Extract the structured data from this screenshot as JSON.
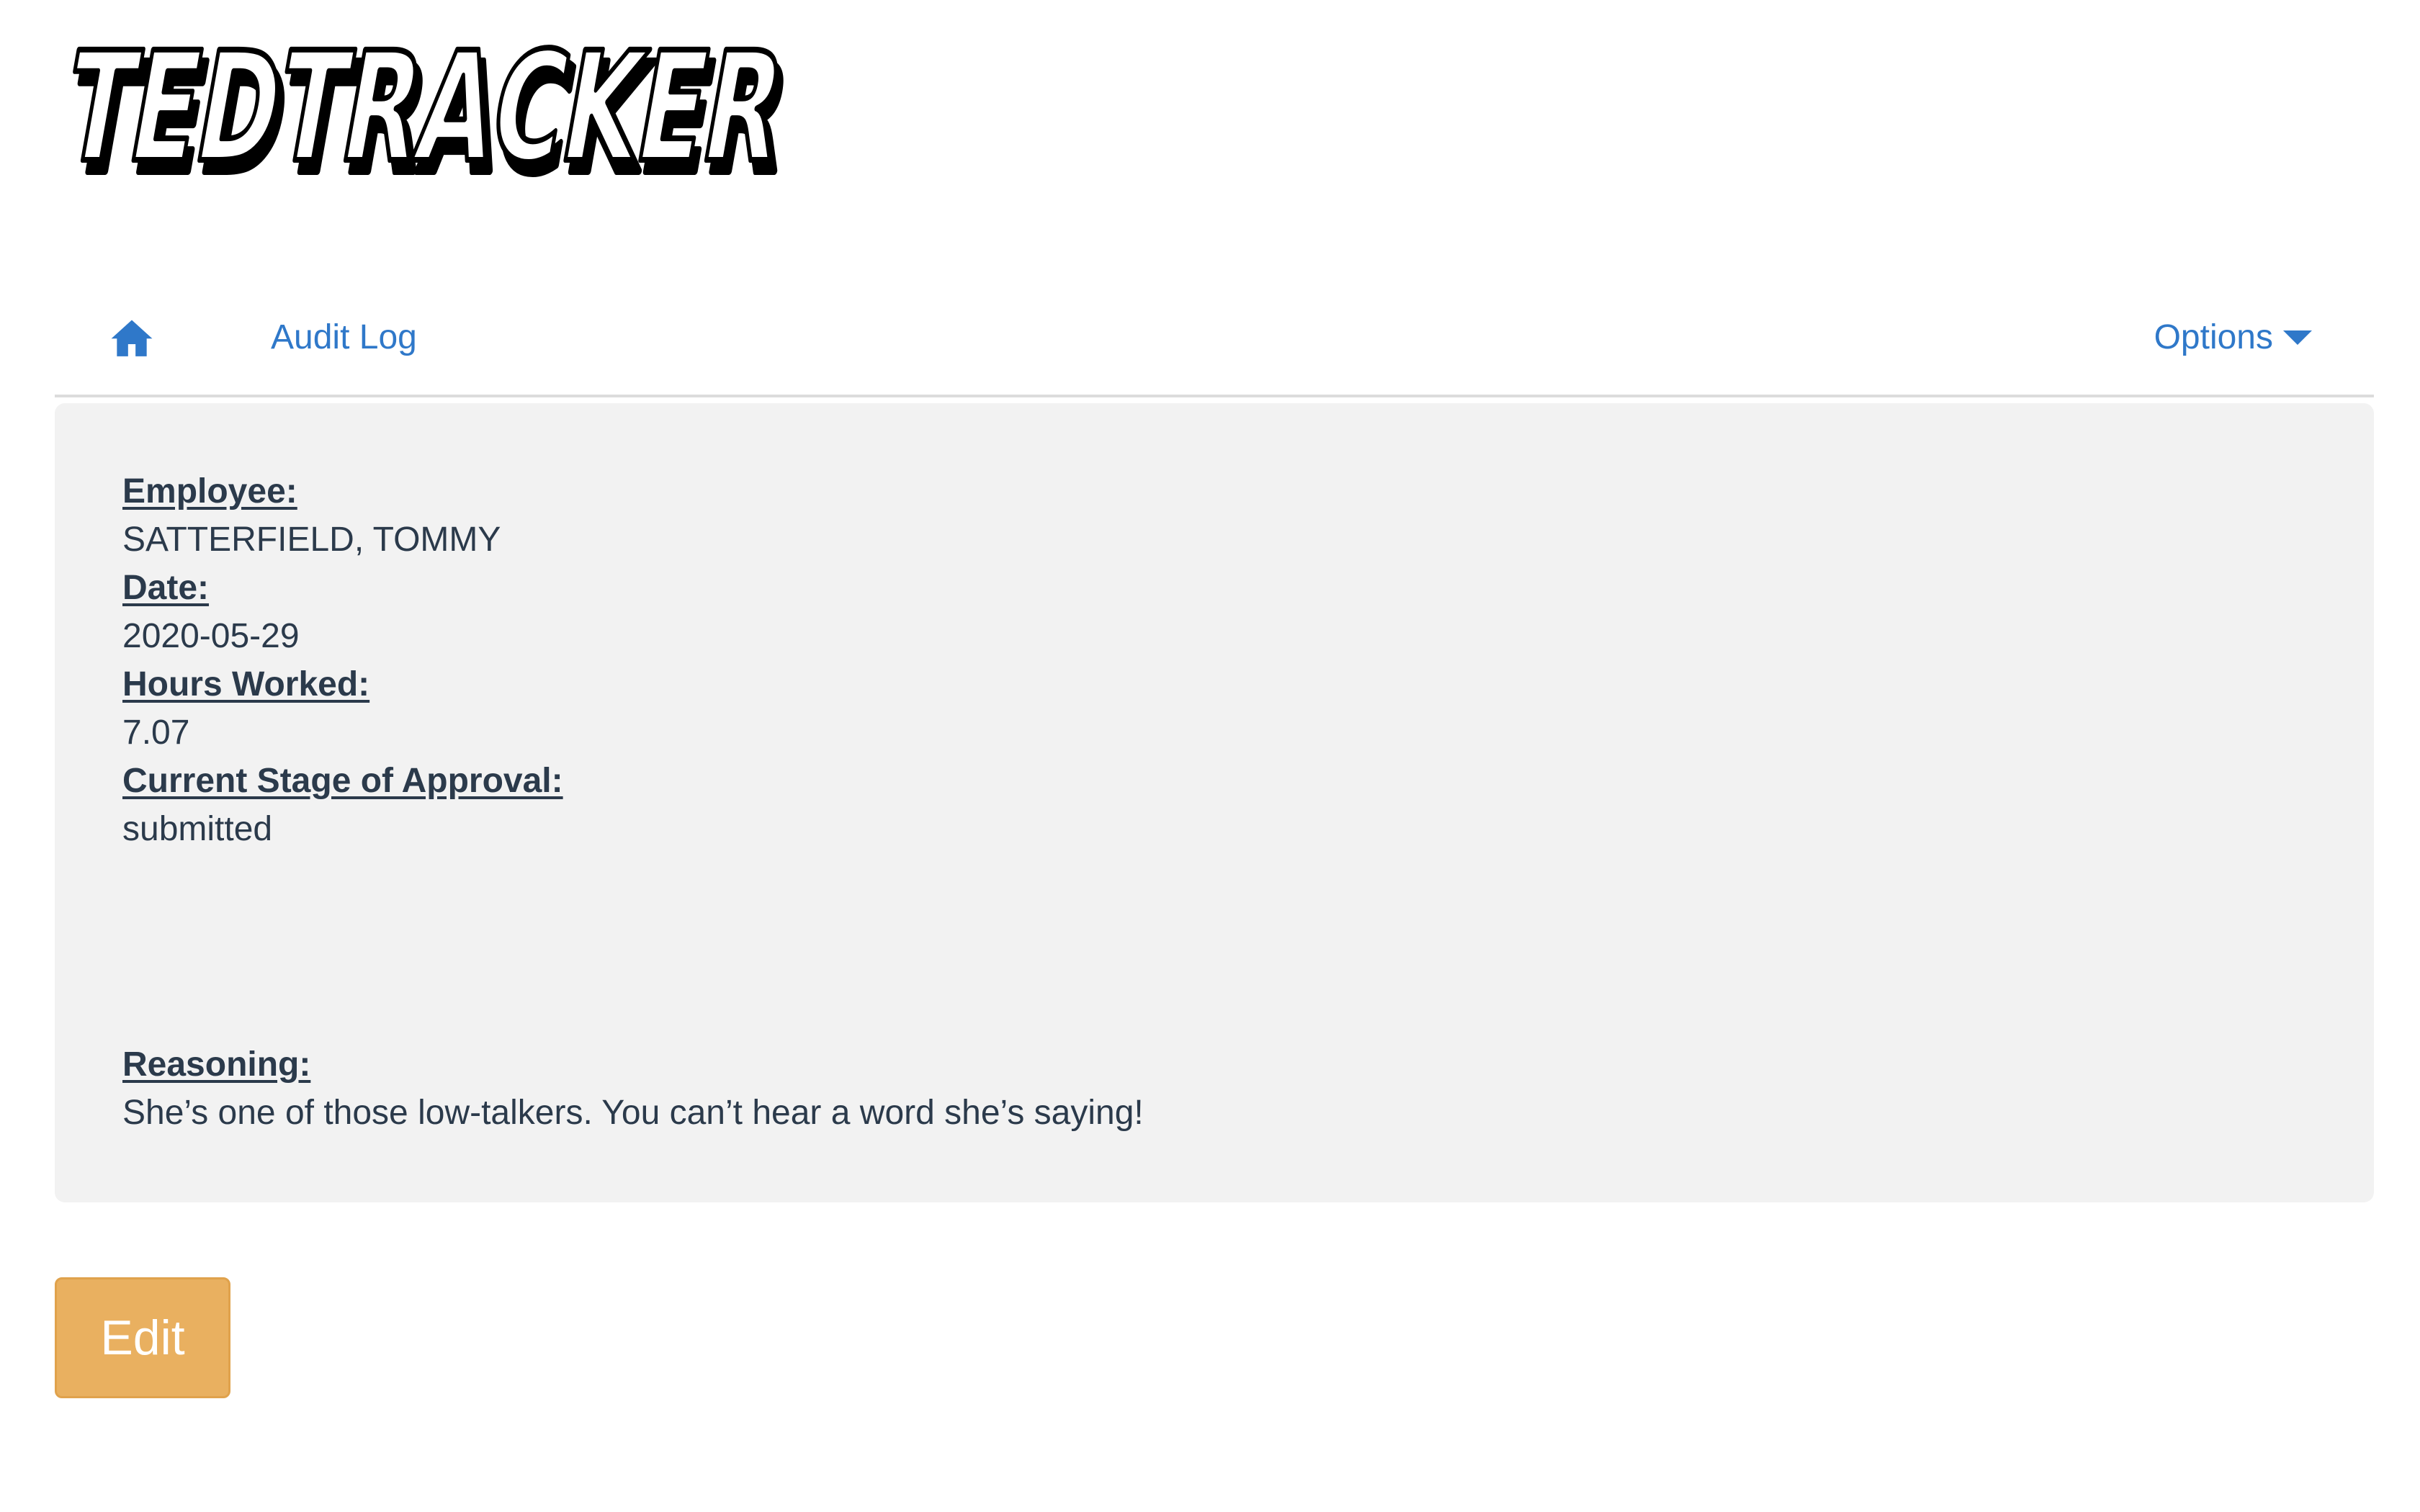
{
  "logo": {
    "text": "TEDTRACKER"
  },
  "nav": {
    "home_icon": "home-icon",
    "audit_log_label": "Audit Log",
    "options_label": "Options",
    "options_icon": "caret-down-icon",
    "accent_color": "#2f78c9"
  },
  "record": {
    "employee_label": "Employee:",
    "employee_value": "SATTERFIELD, TOMMY",
    "date_label": "Date:",
    "date_value": "2020-05-29",
    "hours_label": "Hours Worked:",
    "hours_value": "7.07",
    "stage_label": "Current Stage of Approval:",
    "stage_value": "submitted",
    "reasoning_label": "Reasoning:",
    "reasoning_value": "She’s one of those low-talkers. You can’t hear a word she’s saying!"
  },
  "actions": {
    "edit_label": "Edit",
    "edit_color": "#e9b060"
  },
  "colors": {
    "panel_background": "#f2f2f2",
    "text": "#2b3a4b"
  }
}
